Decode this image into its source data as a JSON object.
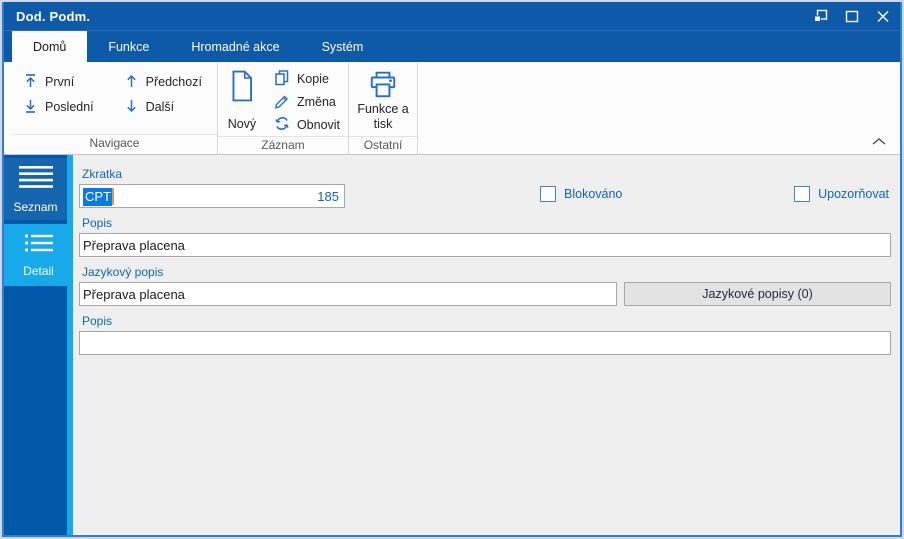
{
  "window": {
    "title": "Dod. Podm.",
    "controls": [
      {
        "name": "restore",
        "icon": "restore-icon"
      },
      {
        "name": "maximize",
        "icon": "maximize-icon"
      },
      {
        "name": "close",
        "icon": "close-icon"
      }
    ]
  },
  "ribbon": {
    "tabs": [
      {
        "label": "Domů",
        "active": true
      },
      {
        "label": "Funkce",
        "active": false
      },
      {
        "label": "Hromadné akce",
        "active": false
      },
      {
        "label": "Systém",
        "active": false
      }
    ],
    "groups": [
      {
        "label": "Navigace",
        "buttons": [
          {
            "label": "První",
            "icon": "arrow-up-bar-icon"
          },
          {
            "label": "Předchozí",
            "icon": "arrow-up-icon"
          },
          {
            "label": "Poslední",
            "icon": "arrow-down-bar-icon"
          },
          {
            "label": "Další",
            "icon": "arrow-down-icon"
          }
        ]
      },
      {
        "label": "Záznam",
        "big_button": {
          "label": "Nový",
          "icon": "new-document-icon"
        },
        "small_buttons": [
          {
            "label": "Kopie",
            "icon": "copy-icon"
          },
          {
            "label": "Změna",
            "icon": "pencil-icon"
          },
          {
            "label": "Obnovit",
            "icon": "refresh-icon"
          }
        ]
      },
      {
        "label": "Ostatní",
        "big_button": {
          "label": "Funkce a tisk",
          "icon": "printer-icon"
        }
      }
    ],
    "collapse_icon": "chevron-up-icon"
  },
  "sidebar": {
    "items": [
      {
        "label": "Seznam",
        "icon": "menu-lines-icon",
        "active": false
      },
      {
        "label": "Detail",
        "icon": "bullet-list-icon",
        "active": true
      }
    ]
  },
  "form": {
    "zkratka": {
      "label": "Zkratka",
      "value": "CPT",
      "value_selected": true,
      "id_number": "185"
    },
    "checkboxes": [
      {
        "label": "Blokováno",
        "checked": false
      },
      {
        "label": "Upozorňovat",
        "checked": false
      }
    ],
    "popis1": {
      "label": "Popis",
      "value": "Přeprava placena"
    },
    "jazykovy_popis": {
      "label": "Jazykový popis",
      "value": "Přeprava placena",
      "button_label": "Jazykové popisy (0)"
    },
    "popis2": {
      "label": "Popis",
      "value": ""
    }
  },
  "colors": {
    "titlebar_blue": "#0f59a9",
    "sidebar_blue": "#0058a8",
    "sidebar_item_blue": "#1566af",
    "accent_cyan": "#18a9ea",
    "selection_blue": "#0d7ae4",
    "caret_orange": "#e39a3b",
    "label_blue": "#1464ac",
    "ribbon_icon_blue": "#2a70c2",
    "content_bg": "#efeff0"
  }
}
